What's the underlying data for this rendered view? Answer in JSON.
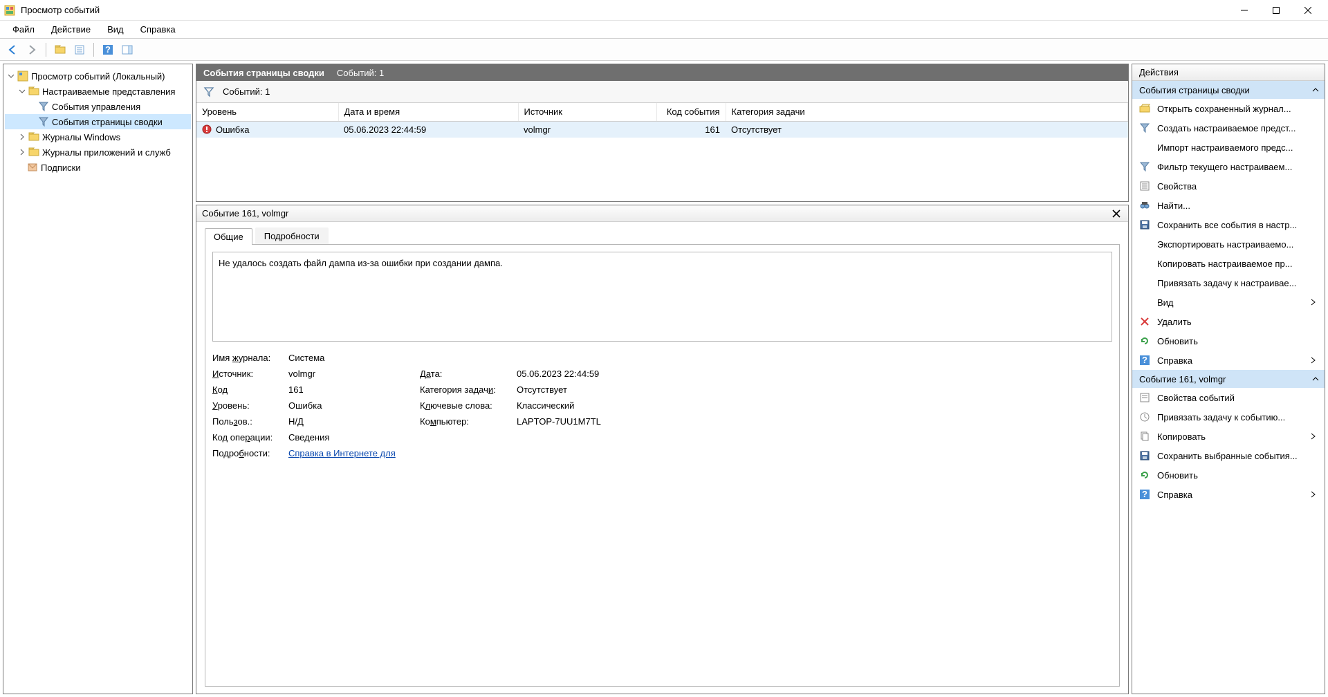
{
  "window": {
    "title": "Просмотр событий"
  },
  "menu": {
    "file": "Файл",
    "action": "Действие",
    "view": "Вид",
    "help": "Справка"
  },
  "tree": {
    "root": "Просмотр событий (Локальный)",
    "custom": "Настраиваемые представления",
    "admin": "События управления",
    "summary": "События страницы сводки",
    "winlogs": "Журналы Windows",
    "applogs": "Журналы приложений и служб",
    "subs": "Подписки"
  },
  "list": {
    "header_main": "События страницы сводки",
    "header_count": "Событий: 1",
    "filter_count": "Событий: 1",
    "cols": {
      "level": "Уровень",
      "datetime": "Дата и время",
      "source": "Источник",
      "id": "Код события",
      "task": "Категория задачи"
    },
    "rows": [
      {
        "level": "Ошибка",
        "datetime": "05.06.2023 22:44:59",
        "source": "volmgr",
        "id": "161",
        "task": "Отсутствует"
      }
    ]
  },
  "detail": {
    "title": "Событие 161, volmgr",
    "tabs": {
      "general": "Общие",
      "details": "Подробности"
    },
    "description": "Не удалось создать файл дампа из-за ошибки при создании дампа.",
    "meta": {
      "logname_k": "Имя журнала:",
      "logname_v": "Система",
      "source_k": "Источник:",
      "source_v": "volmgr",
      "date_k": "Дата:",
      "date_v": "05.06.2023 22:44:59",
      "id_k": "Код",
      "id_v": "161",
      "task_k": "Категория задачи:",
      "task_v": "Отсутствует",
      "level_k": "Уровень:",
      "level_v": "Ошибка",
      "keywords_k": "Ключевые слова:",
      "keywords_v": "Классический",
      "user_k": "Пользов.:",
      "user_v": "Н/Д",
      "computer_k": "Компьютер:",
      "computer_v": "LAPTOP-7UU1M7TL",
      "opcode_k": "Код операции:",
      "opcode_v": "Сведения",
      "more_k": "Подробности:",
      "more_link": "Справка в Интернете для "
    }
  },
  "actions": {
    "pane_title": "Действия",
    "group1": "События страницы сводки",
    "g1": {
      "open": "Открыть сохраненный журнал...",
      "create": "Создать настраиваемое предст...",
      "import": "Импорт настраиваемого предс...",
      "filter": "Фильтр текущего настраиваем...",
      "props": "Свойства",
      "find": "Найти...",
      "saveall": "Сохранить все события в настр...",
      "export": "Экспортировать настраиваемо...",
      "copy": "Копировать настраиваемое пр...",
      "attach": "Привязать задачу к настраивае...",
      "view": "Вид",
      "delete": "Удалить",
      "refresh": "Обновить",
      "help": "Справка"
    },
    "group2": "Событие 161, volmgr",
    "g2": {
      "evtprops": "Свойства событий",
      "evtattach": "Привязать задачу к событию...",
      "evtcopy": "Копировать",
      "evtsave": "Сохранить выбранные события...",
      "evtrefresh": "Обновить",
      "evthelp": "Справка"
    }
  }
}
